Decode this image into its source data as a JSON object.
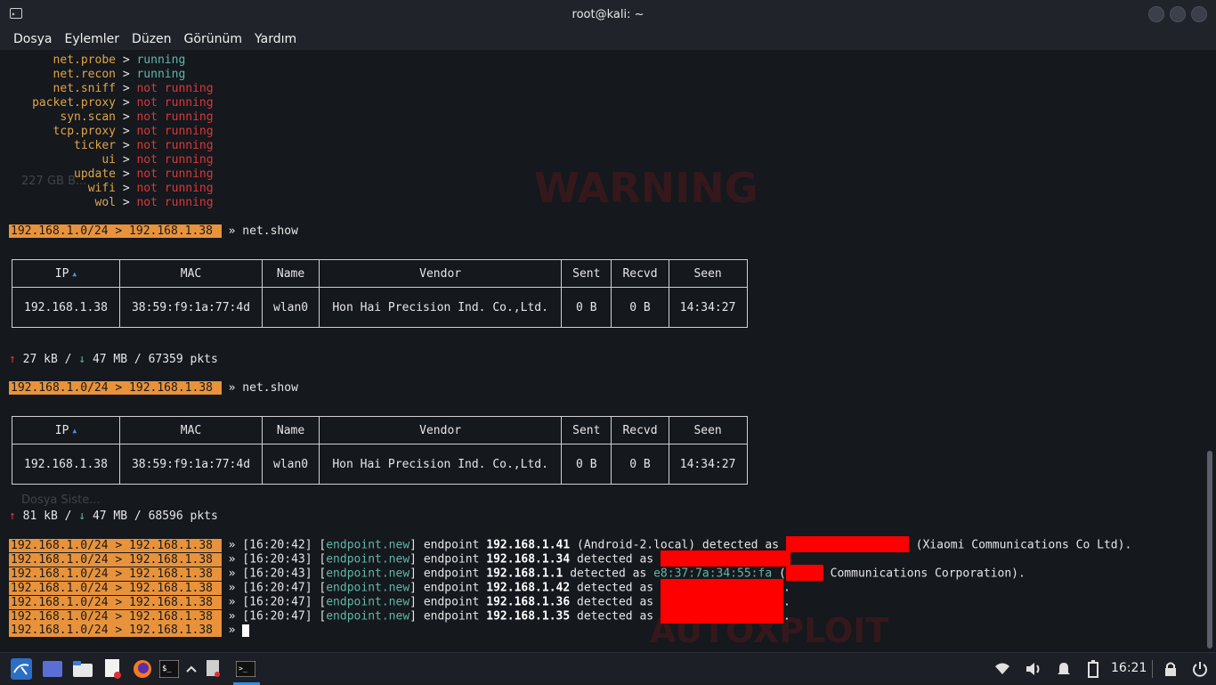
{
  "window": {
    "title": "root@kali: ~"
  },
  "menu": [
    "Dosya",
    "Eylemler",
    "Düzen",
    "Görünüm",
    "Yardım"
  ],
  "modules": [
    {
      "name": "net.probe",
      "status": "running"
    },
    {
      "name": "net.recon",
      "status": "running"
    },
    {
      "name": "net.sniff",
      "status": "not running"
    },
    {
      "name": "packet.proxy",
      "status": "not running"
    },
    {
      "name": "syn.scan",
      "status": "not running"
    },
    {
      "name": "tcp.proxy",
      "status": "not running"
    },
    {
      "name": "ticker",
      "status": "not running"
    },
    {
      "name": "ui",
      "status": "not running"
    },
    {
      "name": "update",
      "status": "not running"
    },
    {
      "name": "wifi",
      "status": "not running"
    },
    {
      "name": "wol",
      "status": "not running"
    }
  ],
  "arrow": ">",
  "prompt": "192.168.1.0/24 > 192.168.1.38 ",
  "prompt_sep": "»",
  "cmd": "net.show",
  "table": {
    "headers": [
      "IP",
      "MAC",
      "Name",
      "Vendor",
      "Sent",
      "Recvd",
      "Seen"
    ],
    "sort_icon": "▲",
    "row": [
      "192.168.1.38",
      "38:59:f9:1a:77:4d",
      "wlan0",
      "Hon Hai Precision Ind. Co.,Ltd.",
      "0 B",
      "0 B",
      "14:34:27"
    ]
  },
  "stats": [
    {
      "up": "27 kB",
      "down": "47 MB",
      "pkts": "67359 pkts"
    },
    {
      "up": "81 kB",
      "down": "47 MB",
      "pkts": "68596 pkts"
    }
  ],
  "stat_up_icon": "↑",
  "stat_down_icon": "↓",
  "stat_sep": "/",
  "events": [
    {
      "time": "[16:20:42]",
      "tag": "endpoint.new",
      "text": "endpoint",
      "ip": "192.168.1.41",
      "extra": "(Android-2.local) detected as",
      "mac": "",
      "tail": "(Xiaomi Communications Co Ltd)."
    },
    {
      "time": "[16:20:43]",
      "tag": "endpoint.new",
      "text": "endpoint",
      "ip": "192.168.1.34",
      "extra": "detected as",
      "mac": "",
      "tail": ""
    },
    {
      "time": "[16:20:43]",
      "tag": "endpoint.new",
      "text": "endpoint",
      "ip": "192.168.1.1",
      "extra": "detected as",
      "mac": "e8:37:7a:34:55:fa",
      "tail": "Communications Corporation)."
    },
    {
      "time": "[16:20:47]",
      "tag": "endpoint.new",
      "text": "endpoint",
      "ip": "192.168.1.42",
      "extra": "detected as",
      "mac": "",
      "tail": "."
    },
    {
      "time": "[16:20:47]",
      "tag": "endpoint.new",
      "text": "endpoint",
      "ip": "192.168.1.36",
      "extra": "detected as",
      "mac": "",
      "tail": "."
    },
    {
      "time": "[16:20:47]",
      "tag": "endpoint.new",
      "text": "endpoint",
      "ip": "192.168.1.35",
      "extra": "detected as",
      "mac": "",
      "tail": "."
    }
  ],
  "bg_text": {
    "warning": "WARNING",
    "autoexploit": "AUTOXPLOIT",
    "disk": "227 GB B...",
    "fs": "Dosya Siste..."
  },
  "taskbar": {
    "clock": "16:21"
  },
  "colors": {
    "prompt_bg": "#e8933c",
    "running": "#5fb8a8",
    "not_running": "#d9383a",
    "key": "#e0a44a",
    "redact": "#ff0000"
  }
}
